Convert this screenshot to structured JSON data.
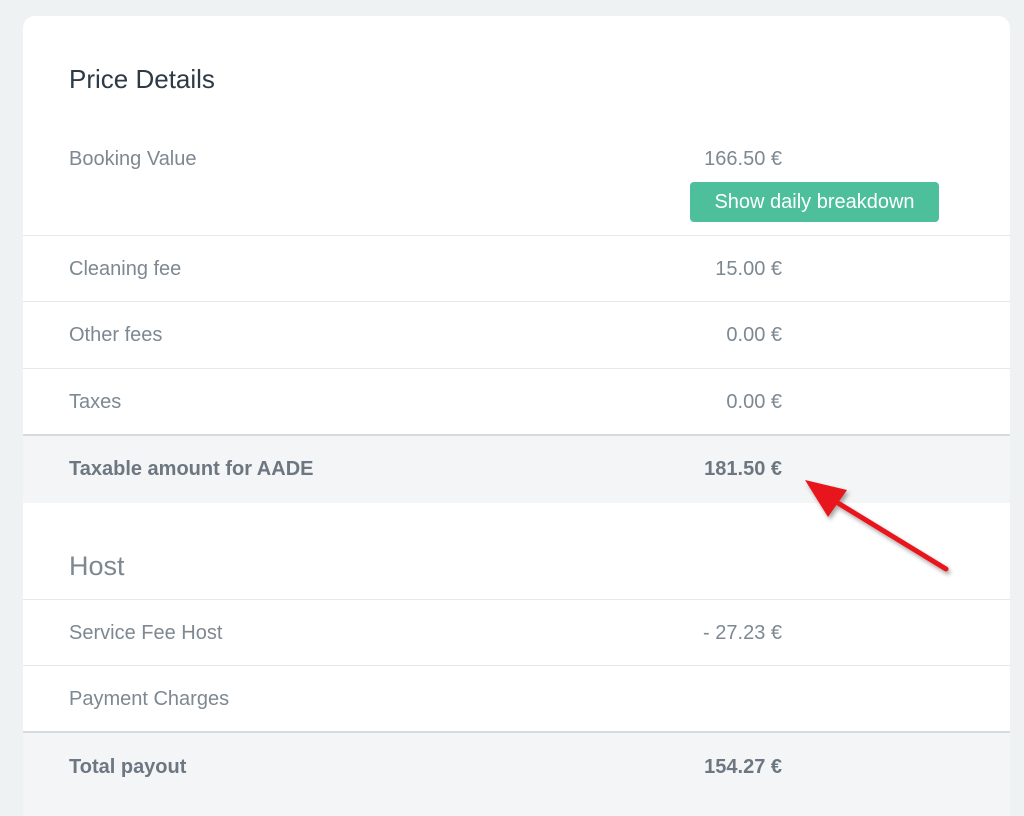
{
  "price_details": {
    "title": "Price Details",
    "booking_value": {
      "label": "Booking Value",
      "amount": "166.50 €"
    },
    "breakdown_button": "Show daily breakdown",
    "rows": [
      {
        "label": "Cleaning fee",
        "amount": "15.00 €"
      },
      {
        "label": "Other fees",
        "amount": "0.00 €"
      },
      {
        "label": "Taxes",
        "amount": "0.00 €"
      }
    ],
    "taxable": {
      "label": "Taxable amount for AADE",
      "amount": "181.50 €"
    }
  },
  "host": {
    "title": "Host",
    "rows": [
      {
        "label": "Service Fee Host",
        "amount": "- 27.23 €"
      },
      {
        "label": "Payment Charges",
        "amount": ""
      }
    ],
    "total": {
      "label": "Total payout",
      "amount": "154.27 €"
    }
  },
  "colors": {
    "accent_button": "#4dbf9a",
    "annotation_arrow": "#e8141a"
  }
}
